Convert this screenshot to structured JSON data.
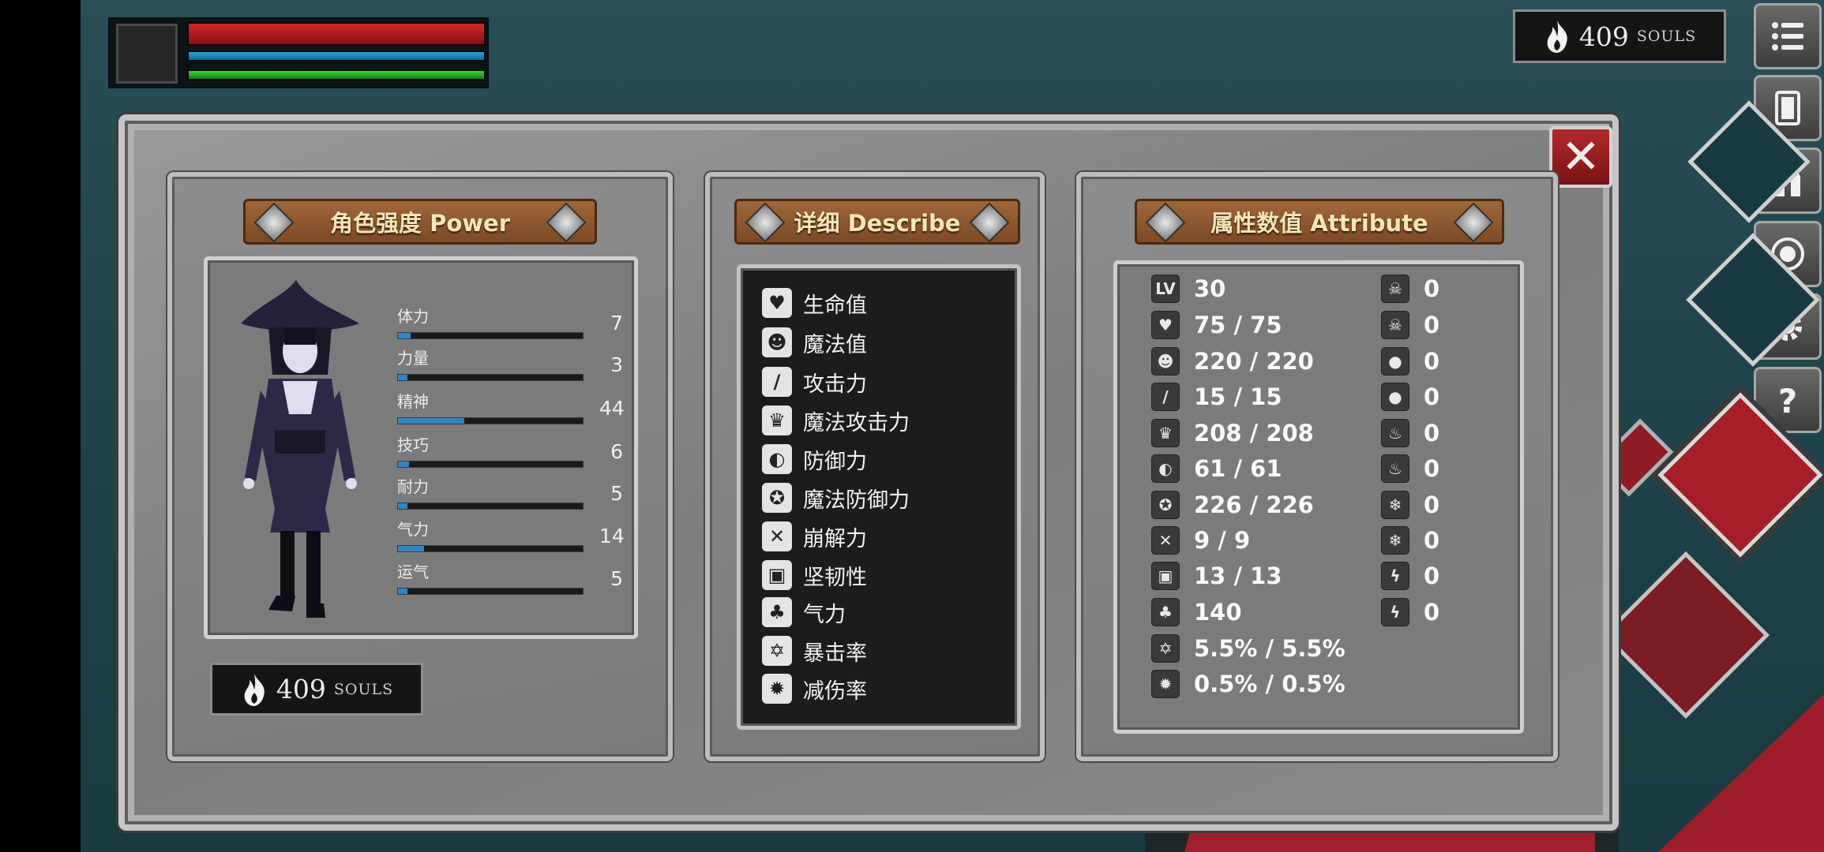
{
  "hud": {
    "souls_value": "409",
    "souls_unit": "SOULS"
  },
  "panel": {
    "power_title": "角色强度 Power",
    "describe_title": "详细 Describe",
    "attribute_title": "属性数值 Attribute",
    "close_label": "✕"
  },
  "stats": [
    {
      "name": "体力",
      "value": "7",
      "fill": 0.07
    },
    {
      "name": "力量",
      "value": "3",
      "fill": 0.05
    },
    {
      "name": "精神",
      "value": "44",
      "fill": 0.36
    },
    {
      "name": "技巧",
      "value": "6",
      "fill": 0.06
    },
    {
      "name": "耐力",
      "value": "5",
      "fill": 0.05
    },
    {
      "name": "气力",
      "value": "14",
      "fill": 0.14
    },
    {
      "name": "运气",
      "value": "5",
      "fill": 0.05
    }
  ],
  "souls": {
    "value": "409",
    "unit": "SOULS"
  },
  "describe": [
    {
      "icon": "heart-icon",
      "glyph": "♥",
      "label": "生命值"
    },
    {
      "icon": "head-icon",
      "glyph": "☻",
      "label": "魔法值"
    },
    {
      "icon": "sword-icon",
      "glyph": "/",
      "label": "攻击力"
    },
    {
      "icon": "crown-icon",
      "glyph": "♛",
      "label": "魔法攻击力"
    },
    {
      "icon": "shield-icon",
      "glyph": "◐",
      "label": "防御力"
    },
    {
      "icon": "magic-shield-icon",
      "glyph": "✪",
      "label": "魔法防御力"
    },
    {
      "icon": "break-icon",
      "glyph": "✕",
      "label": "崩解力"
    },
    {
      "icon": "helmet-icon",
      "glyph": "▣",
      "label": "坚韧性"
    },
    {
      "icon": "lungs-icon",
      "glyph": "♣",
      "label": "气力"
    },
    {
      "icon": "star-icon",
      "glyph": "✡",
      "label": "暴击率"
    },
    {
      "icon": "reduce-icon",
      "glyph": "✹",
      "label": "减伤率"
    }
  ],
  "attributes_left": [
    {
      "icon": "lv-icon",
      "glyph": "LV",
      "value": "30"
    },
    {
      "icon": "heart-icon",
      "glyph": "♥",
      "value": "75 / 75"
    },
    {
      "icon": "head-icon",
      "glyph": "☻",
      "value": "220 / 220"
    },
    {
      "icon": "sword-icon",
      "glyph": "/",
      "value": "15 / 15"
    },
    {
      "icon": "crown-icon",
      "glyph": "♛",
      "value": "208 / 208"
    },
    {
      "icon": "shield-icon",
      "glyph": "◐",
      "value": "61 / 61"
    },
    {
      "icon": "magic-shield-icon",
      "glyph": "✪",
      "value": "226 / 226"
    },
    {
      "icon": "break-icon",
      "glyph": "✕",
      "value": "9 / 9"
    },
    {
      "icon": "helmet-icon",
      "glyph": "▣",
      "value": "13 / 13"
    },
    {
      "icon": "lungs-icon",
      "glyph": "♣",
      "value": "140"
    },
    {
      "icon": "star-icon",
      "glyph": "✡",
      "value": "5.5% / 5.5%"
    },
    {
      "icon": "reduce-icon",
      "glyph": "✹",
      "value": "0.5% / 0.5%"
    }
  ],
  "attributes_right": [
    {
      "icon": "skull-icon",
      "glyph": "☠",
      "value": "0"
    },
    {
      "icon": "skull-resist-icon",
      "glyph": "☠",
      "value": "0"
    },
    {
      "icon": "blood-icon",
      "glyph": "●",
      "value": "0"
    },
    {
      "icon": "blood-resist-icon",
      "glyph": "●",
      "value": "0"
    },
    {
      "icon": "fire-icon",
      "glyph": "♨",
      "value": "0"
    },
    {
      "icon": "fire-resist-icon",
      "glyph": "♨",
      "value": "0"
    },
    {
      "icon": "frost-icon",
      "glyph": "❄",
      "value": "0"
    },
    {
      "icon": "frost-resist-icon",
      "glyph": "❄",
      "value": "0"
    },
    {
      "icon": "lightning-icon",
      "glyph": "ϟ",
      "value": "0"
    },
    {
      "icon": "lightning-resist-icon",
      "glyph": "ϟ",
      "value": "0"
    }
  ]
}
